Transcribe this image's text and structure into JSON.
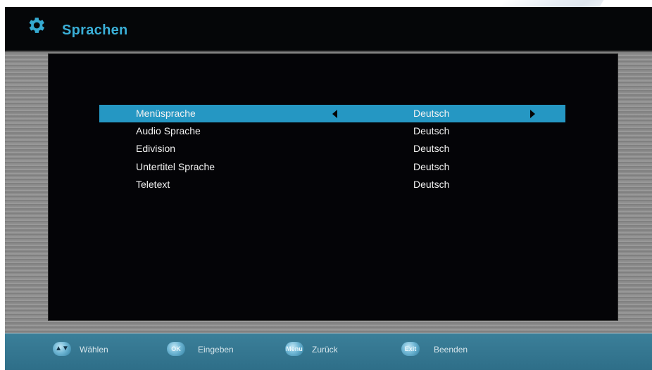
{
  "header": {
    "title": "Sprachen",
    "icon": "gear-icon"
  },
  "menu": {
    "rows": [
      {
        "label": "Menüsprache",
        "value": "Deutsch",
        "selected": true
      },
      {
        "label": "Audio Sprache",
        "value": "Deutsch",
        "selected": false
      },
      {
        "label": "Edivision",
        "value": "Deutsch",
        "selected": false
      },
      {
        "label": "Untertitel Sprache",
        "value": "Deutsch",
        "selected": false
      },
      {
        "label": "Teletext",
        "value": "Deutsch",
        "selected": false
      }
    ]
  },
  "footer": {
    "keys": [
      {
        "button": "",
        "icon": "up-down-arrows-icon",
        "label": "Wählen"
      },
      {
        "button": "OK",
        "label": "Eingeben"
      },
      {
        "button": "Menu",
        "label": "Zurück"
      },
      {
        "button": "Exit",
        "label": "Beenden"
      }
    ]
  },
  "colors": {
    "accent": "#2597c3",
    "title": "#3aaed6",
    "footer": "#2e6e88",
    "panel": "#040407"
  }
}
